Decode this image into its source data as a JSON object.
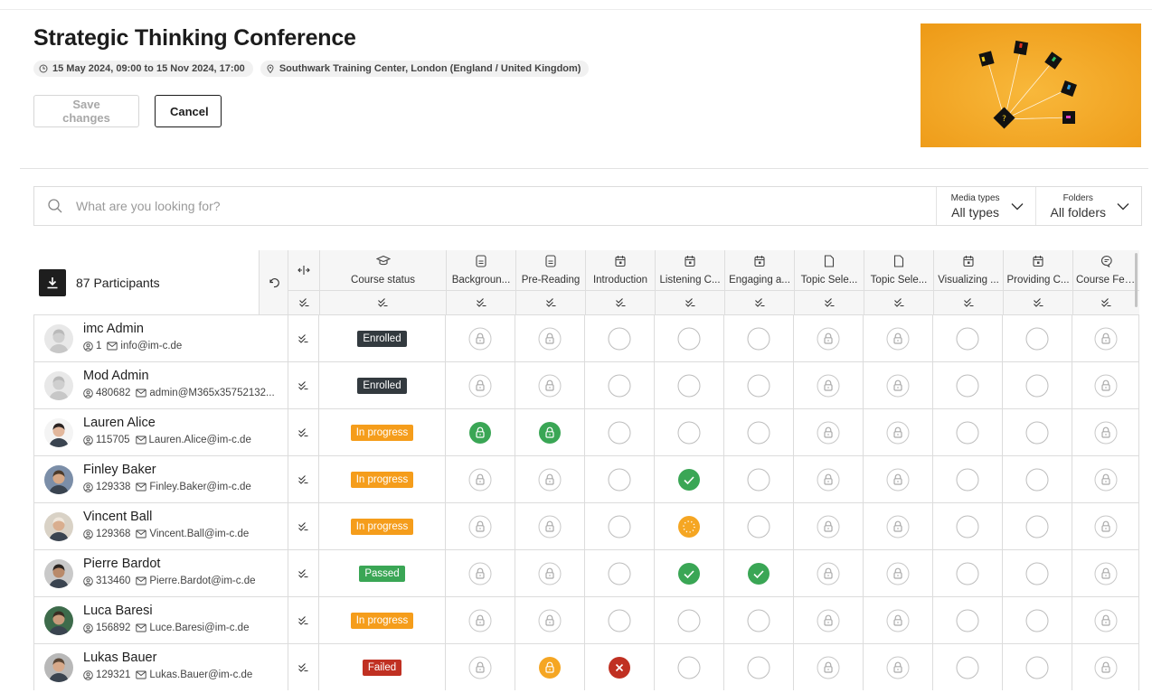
{
  "event": {
    "title": "Strategic Thinking Conference",
    "date": "15 May 2024, 09:00 to 15 Nov 2024, 17:00",
    "location": "Southwark Training Center, London (England / United Kingdom)"
  },
  "actions": {
    "save_label": "Save changes",
    "cancel_label": "Cancel"
  },
  "search": {
    "placeholder": "What are you looking for?",
    "media_label": "Media types",
    "media_value": "All types",
    "folders_label": "Folders",
    "folders_value": "All folders"
  },
  "table": {
    "participants_label": "87 Participants",
    "columns": [
      {
        "label": "Course status",
        "icon": "graduation-cap-icon"
      },
      {
        "label": "Backgroun...",
        "icon": "document-icon"
      },
      {
        "label": "Pre-Reading",
        "icon": "document-icon"
      },
      {
        "label": "Introduction",
        "icon": "calendar-icon"
      },
      {
        "label": "Listening C...",
        "icon": "calendar-icon"
      },
      {
        "label": "Engaging a...",
        "icon": "calendar-icon"
      },
      {
        "label": "Topic Sele...",
        "icon": "file-icon"
      },
      {
        "label": "Topic Sele...",
        "icon": "file-icon"
      },
      {
        "label": "Visualizing ...",
        "icon": "calendar-icon"
      },
      {
        "label": "Providing C...",
        "icon": "calendar-icon"
      },
      {
        "label": "Course Fee...",
        "icon": "chat-icon"
      }
    ],
    "rows": [
      {
        "name": "imc Admin",
        "id": "1",
        "email": "info@im-c.de",
        "status": "Enrolled",
        "status_type": "enrolled",
        "cells": [
          "locked",
          "locked",
          "empty",
          "empty",
          "empty",
          "locked",
          "locked",
          "empty",
          "empty",
          "locked"
        ]
      },
      {
        "name": "Mod Admin",
        "id": "480682",
        "email": "admin@M365x35752132...",
        "status": "Enrolled",
        "status_type": "enrolled",
        "cells": [
          "locked",
          "locked",
          "empty",
          "empty",
          "empty",
          "locked",
          "locked",
          "empty",
          "empty",
          "locked"
        ]
      },
      {
        "name": "Lauren Alice",
        "id": "115705",
        "email": "Lauren.Alice@im-c.de",
        "status": "In progress",
        "status_type": "progress",
        "cells": [
          "unlocked-green",
          "unlocked-green",
          "empty",
          "empty",
          "empty",
          "locked",
          "locked",
          "empty",
          "empty",
          "locked"
        ]
      },
      {
        "name": "Finley Baker",
        "id": "129338",
        "email": "Finley.Baker@im-c.de",
        "status": "In progress",
        "status_type": "progress",
        "cells": [
          "locked",
          "locked",
          "empty",
          "done",
          "empty",
          "locked",
          "locked",
          "empty",
          "empty",
          "locked"
        ]
      },
      {
        "name": "Vincent Ball",
        "id": "129368",
        "email": "Vincent.Ball@im-c.de",
        "status": "In progress",
        "status_type": "progress",
        "cells": [
          "locked",
          "locked",
          "empty",
          "in-progress",
          "empty",
          "locked",
          "locked",
          "empty",
          "empty",
          "locked"
        ]
      },
      {
        "name": "Pierre Bardot",
        "id": "313460",
        "email": "Pierre.Bardot@im-c.de",
        "status": "Passed",
        "status_type": "passed",
        "cells": [
          "locked",
          "locked",
          "empty",
          "done",
          "done",
          "locked",
          "locked",
          "empty",
          "empty",
          "locked"
        ]
      },
      {
        "name": "Luca Baresi",
        "id": "156892",
        "email": "Luce.Baresi@im-c.de",
        "status": "In progress",
        "status_type": "progress",
        "cells": [
          "locked",
          "locked",
          "empty",
          "empty",
          "empty",
          "locked",
          "locked",
          "empty",
          "empty",
          "locked"
        ]
      },
      {
        "name": "Lukas Bauer",
        "id": "129321",
        "email": "Lukas.Bauer@im-c.de",
        "status": "Failed",
        "status_type": "failed",
        "cells": [
          "locked",
          "unlocked-orange",
          "failed",
          "empty",
          "empty",
          "locked",
          "locked",
          "empty",
          "empty",
          "locked"
        ]
      }
    ]
  },
  "colors": {
    "enrolled": "#333a3f",
    "progress": "#f59d1b",
    "passed": "#3aa655",
    "failed": "#c03022",
    "green": "#3aa655",
    "orange": "#f5a623",
    "banner": "#f3a623"
  }
}
